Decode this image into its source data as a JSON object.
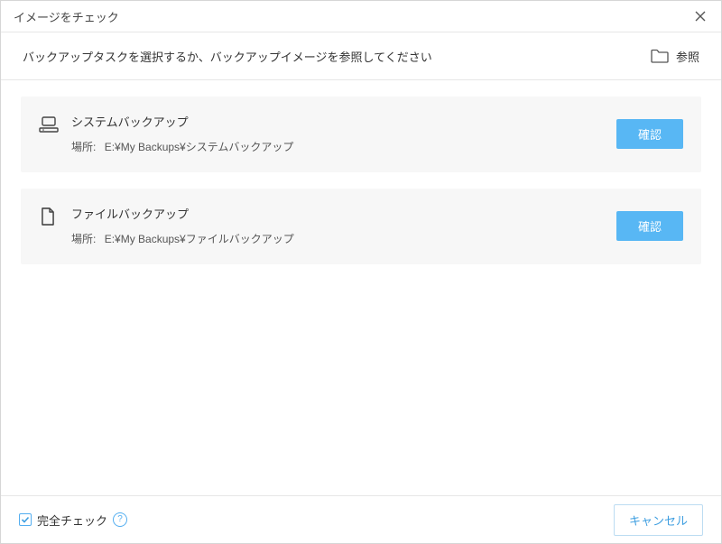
{
  "window": {
    "title": "イメージをチェック"
  },
  "instruction": {
    "text": "バックアップタスクを選択するか、バックアップイメージを参照してください",
    "browse_label": "参照"
  },
  "tasks": [
    {
      "title": "システムバックアップ",
      "location_label": "場所:",
      "location_value": "E:¥My Backups¥システムバックアップ",
      "confirm_label": "確認",
      "icon": "system-backup-icon"
    },
    {
      "title": "ファイルバックアップ",
      "location_label": "場所:",
      "location_value": "E:¥My Backups¥ファイルバックアップ",
      "confirm_label": "確認",
      "icon": "file-backup-icon"
    }
  ],
  "footer": {
    "full_check_label": "完全チェック",
    "full_check_checked": true,
    "cancel_label": "キャンセル",
    "help_symbol": "?"
  }
}
